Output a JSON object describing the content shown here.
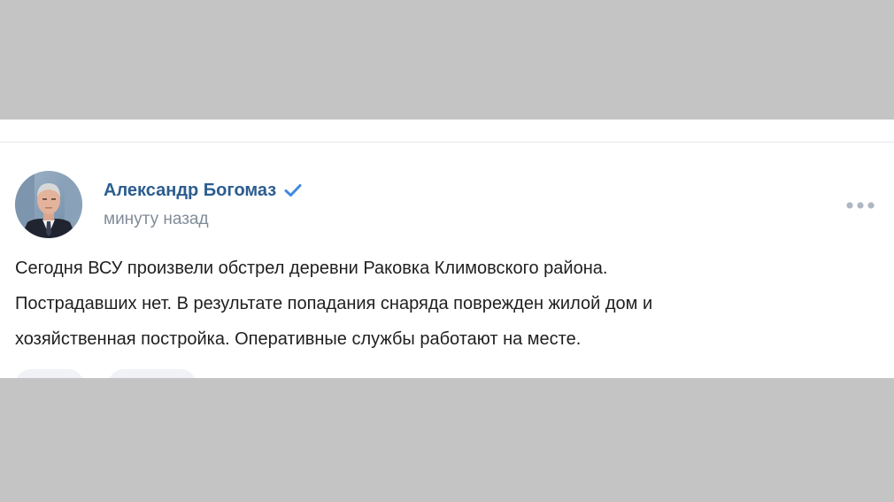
{
  "post": {
    "author": {
      "name": "Александр Богомаз",
      "verified_icon": "verified-checkmark-icon",
      "avatar": "author-portrait"
    },
    "timestamp": "минуту назад",
    "menu_icon": "more-dots-icon",
    "text_lines": [
      "Сегодня ВСУ произвели обстрел деревни Раковка Климовского района.",
      "Пострадавших нет. В результате попадания снаряда поврежден жилой дом и",
      "хозяйственная постройка. Оперативные службы работают на месте."
    ],
    "actions": [
      {
        "name": "like-button"
      },
      {
        "name": "comment-button"
      }
    ]
  },
  "colors": {
    "background_gray": "#c4c4c4",
    "author_link": "#2c5d8f",
    "verified": "#3f8ae0",
    "timestamp": "#818c99",
    "text": "#1f1f1f",
    "icon_gray": "#aeb7c2"
  }
}
